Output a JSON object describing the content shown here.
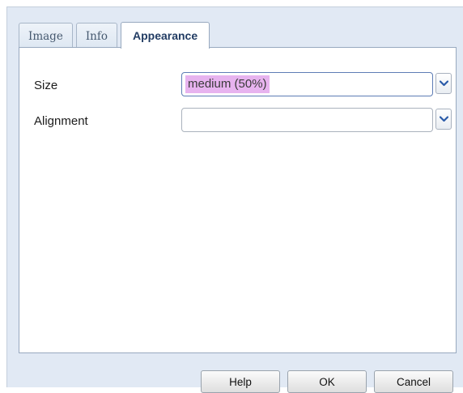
{
  "tabs": [
    {
      "label": "Image"
    },
    {
      "label": "Info"
    },
    {
      "label": "Appearance"
    }
  ],
  "active_tab": "Appearance",
  "fields": {
    "size": {
      "label": "Size",
      "value": "medium (50%)"
    },
    "alignment": {
      "label": "Alignment",
      "value": ""
    }
  },
  "buttons": {
    "help": "Help",
    "ok": "OK",
    "cancel": "Cancel"
  },
  "colors": {
    "dialog_background": "#e1e9f4",
    "active_tab_text": "#223c63",
    "selection_highlight": "#e7b3ef",
    "dropdown_arrow": "#2a5aa8"
  },
  "icons": {
    "dropdown": "chevron-down-icon"
  }
}
